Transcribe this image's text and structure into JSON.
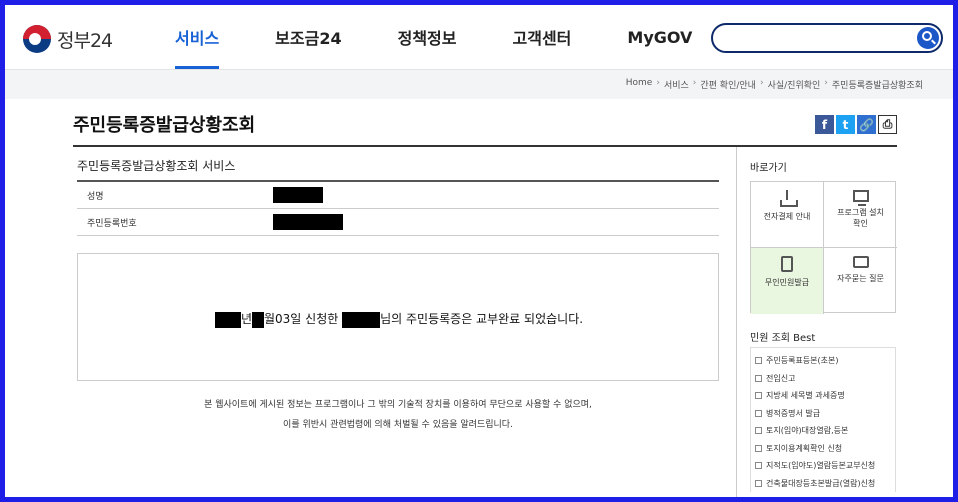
{
  "header": {
    "logo_text": "정부24",
    "nav": [
      "서비스",
      "보조금24",
      "정책정보",
      "고객센터",
      "MyGOV"
    ],
    "active_nav": "서비스",
    "search_placeholder": ""
  },
  "breadcrumb": [
    "Home",
    "서비스",
    "간편 확인/안내",
    "사실/진위확인",
    "주민등록증발급상황조회"
  ],
  "page": {
    "title": "주민등록증발급상황조회",
    "share": {
      "facebook": "f",
      "twitter": "t",
      "link": "🔗",
      "print": "⎙"
    }
  },
  "main": {
    "section_title": "주민등록증발급상황조회 서비스",
    "fields": [
      {
        "label": "성명"
      },
      {
        "label": "주민등록번호"
      }
    ],
    "result": {
      "part_year": "년",
      "part_month_day": "월03일 신청한",
      "part_tail": "님의 주민등록증은 교부완료 되었습니다."
    },
    "notice_line1": "본 웹사이트에 게시된 정보는 프로그램이나 그 밖의 기술적 장치를 이용하여 무단으로 사용할 수 없으며,",
    "notice_line2": "이를 위반시 관련법령에 의해 처벌될 수 있음을 알려드립니다."
  },
  "sidebar": {
    "quick_title": "바로가기",
    "quick_links": [
      {
        "label": "전자결제 안내",
        "icon": "download-icon"
      },
      {
        "label": "프로그램 설치 확인",
        "icon": "monitor-icon"
      },
      {
        "label": "무인민원발급",
        "icon": "kiosk-icon"
      },
      {
        "label": "자주묻는 질문",
        "icon": "faq-icon"
      }
    ],
    "best_title": "민원 조회 Best",
    "best_items": [
      "주민등록표등본(초본)",
      "전입신고",
      "지방세 세목별 과세증명",
      "병적증명서 발급",
      "토지(임야)대장열람,등본",
      "토지이용계획확인 신청",
      "지적도(임야도)열람등본교부신청",
      "건축물대장등초본발급(열람)신청"
    ]
  },
  "colors": {
    "frame_border": "#1e1ee6",
    "accent": "#1862d6",
    "search_border": "#0e2a6b",
    "quick_highlight": "#e9f6e0"
  }
}
